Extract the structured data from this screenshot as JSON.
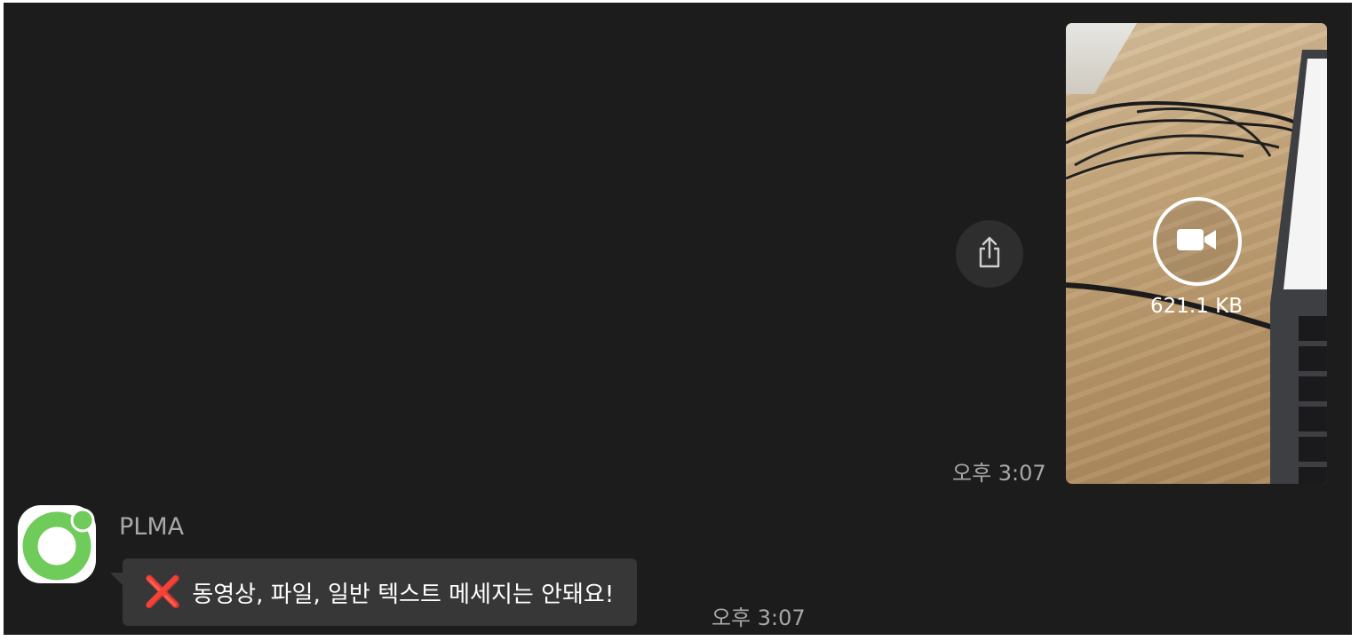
{
  "outgoing": {
    "share_icon": "share-icon",
    "timestamp": "오후 3:07",
    "video": {
      "icon": "video-camera-icon",
      "file_size": "621.1 KB"
    }
  },
  "incoming": {
    "sender": "PLMA",
    "avatar_icon": "plma-logo-icon",
    "status_icon": "cross-mark-icon",
    "status_icon_glyph": "❌",
    "message": "동영상, 파일, 일반 텍스트 메세지는 안돼요!",
    "timestamp": "오후 3:07"
  },
  "colors": {
    "background": "#1c1c1c",
    "bubble": "#373737",
    "timestamp": "#a8a8a8",
    "logo_green": "#6fcb5a",
    "cross_red": "#e53935"
  }
}
